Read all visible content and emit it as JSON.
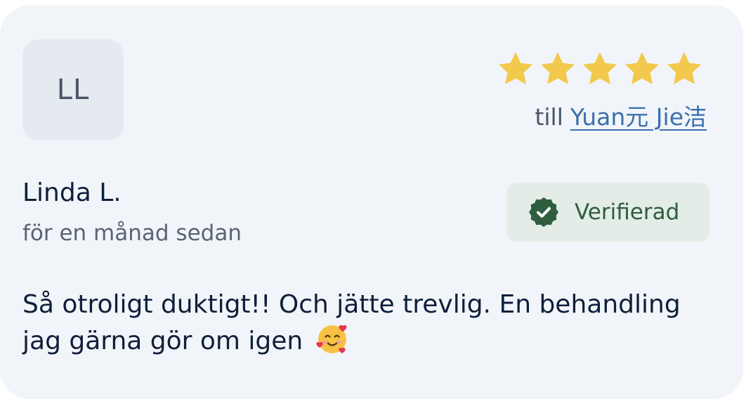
{
  "reviewer": {
    "initials": "LL",
    "name": "Linda L.",
    "time_ago": "för en månad sedan"
  },
  "rating": {
    "value": 5,
    "max": 5,
    "star_color": "#f2c94c"
  },
  "recipient": {
    "prefix": "till",
    "name": "Yuan元 Jie洁"
  },
  "badge": {
    "label": "Verifierad",
    "icon": "verified-check-icon",
    "color": "#2e5e3e"
  },
  "review": {
    "text": "Så otroligt duktigt!! Och jätte trevlig. En behandling jag gärna gör om igen",
    "emoji": "smiling-face-with-hearts"
  }
}
